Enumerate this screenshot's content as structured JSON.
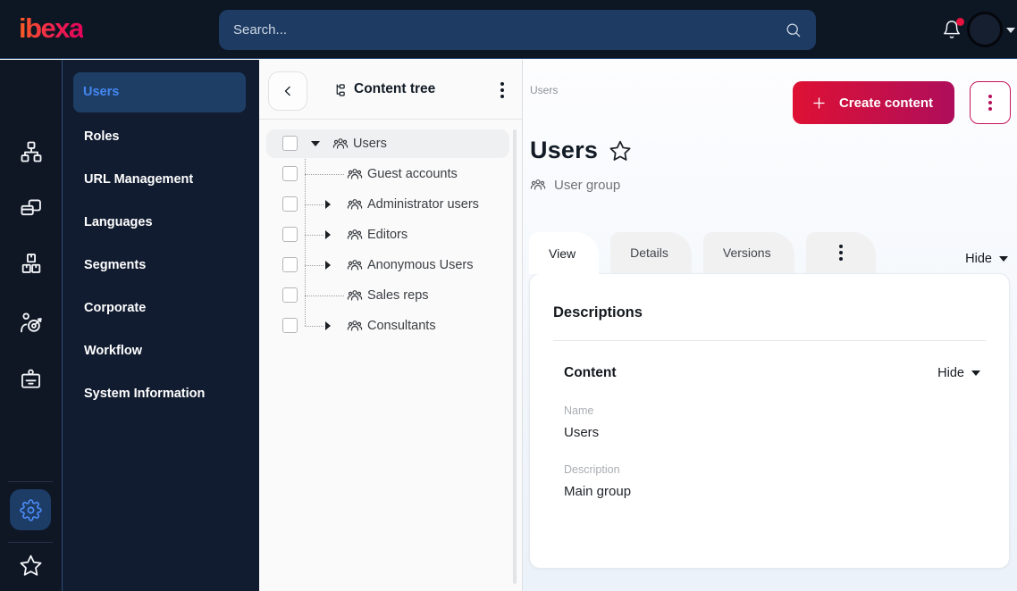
{
  "topbar": {
    "logo": "ibexa",
    "search": {
      "placeholder": "Search..."
    }
  },
  "rail": {
    "items": [
      {
        "icon": "sitemap-icon"
      },
      {
        "icon": "pages-icon"
      },
      {
        "icon": "boxes-icon"
      },
      {
        "icon": "audience-target-icon"
      },
      {
        "icon": "badge-icon"
      }
    ],
    "bottom": [
      {
        "icon": "gear-icon",
        "active": true
      },
      {
        "icon": "star-icon",
        "active": false
      }
    ]
  },
  "side_menu": {
    "items": [
      {
        "label": "Users",
        "active": true
      },
      {
        "label": "Roles",
        "active": false
      },
      {
        "label": "URL Management",
        "active": false
      },
      {
        "label": "Languages",
        "active": false
      },
      {
        "label": "Segments",
        "active": false
      },
      {
        "label": "Corporate",
        "active": false
      },
      {
        "label": "Workflow",
        "active": false
      },
      {
        "label": "System Information",
        "active": false
      }
    ]
  },
  "content_tree": {
    "title": "Content tree",
    "items": [
      {
        "label": "Users",
        "expanded": true,
        "selected": true
      },
      {
        "label": "Guest accounts",
        "collapsible": false
      },
      {
        "label": "Administrator users",
        "collapsible": true
      },
      {
        "label": "Editors",
        "collapsible": true
      },
      {
        "label": "Anonymous Users",
        "collapsible": true
      },
      {
        "label": "Sales reps",
        "collapsible": false
      },
      {
        "label": "Consultants",
        "collapsible": true
      }
    ]
  },
  "main": {
    "breadcrumb": "Users",
    "create_button": "Create content",
    "title": "Users",
    "content_type": "User group",
    "tabs": [
      {
        "label": "View",
        "active": true
      },
      {
        "label": "Details",
        "active": false
      },
      {
        "label": "Versions",
        "active": false
      }
    ],
    "hide_toggle": "Hide",
    "card": {
      "heading": "Descriptions",
      "section_title": "Content",
      "section_hide": "Hide",
      "fields": [
        {
          "label": "Name",
          "value": "Users"
        },
        {
          "label": "Description",
          "value": "Main group"
        }
      ]
    }
  },
  "colors": {
    "topbar_bg": "#0d1623",
    "brand_gradient": [
      "#f95d25",
      "#e2045a"
    ],
    "primary_button_gradient": [
      "#de1134",
      "#af0e5b"
    ],
    "active_menu_bg": "#1e3e66",
    "active_menu_text": "#4487f0",
    "notification_dot": "#e8143f"
  }
}
